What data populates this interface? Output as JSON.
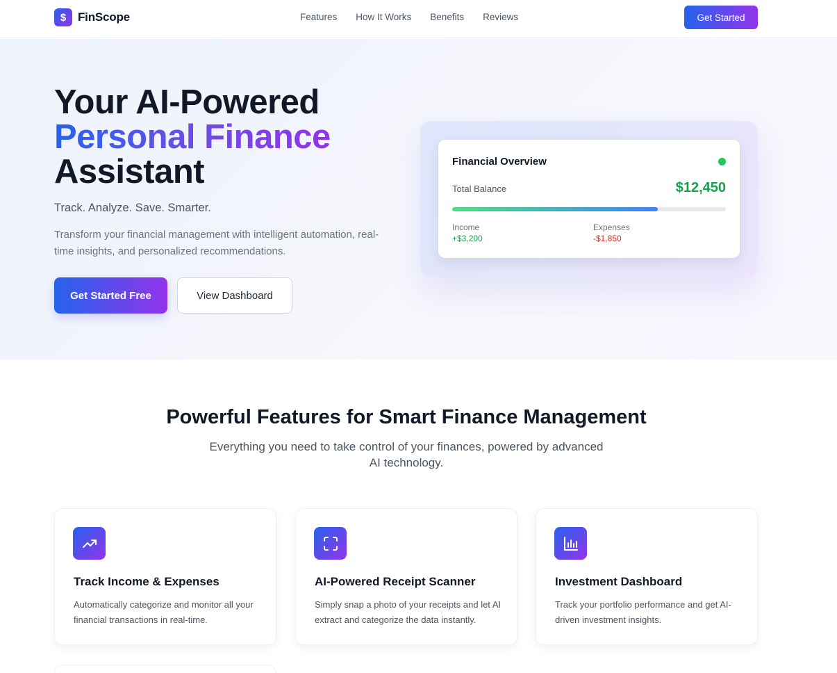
{
  "brand": {
    "logo_glyph": "$",
    "name": "FinScope"
  },
  "nav": {
    "links": [
      "Features",
      "How It Works",
      "Benefits",
      "Reviews"
    ],
    "cta": "Get Started"
  },
  "hero": {
    "title_line1": "Your AI-Powered",
    "title_line2": "Personal Finance",
    "title_line3": "Assistant",
    "tagline": "Track. Analyze. Save. Smarter.",
    "description": "Transform your financial management with intelligent automation, real-time insights, and personalized recommendations.",
    "primary_button": "Get Started Free",
    "secondary_button": "View Dashboard"
  },
  "overview": {
    "title": "Financial Overview",
    "balance_label": "Total Balance",
    "balance": "$12,450",
    "progress_fraction": 0.75,
    "income_label": "Income",
    "income": "+$3,200",
    "expenses_label": "Expenses",
    "expenses": "-$1,850"
  },
  "features": {
    "title": "Powerful Features for Smart Finance Management",
    "subtitle": "Everything you need to take control of your finances, powered by advanced AI technology.",
    "cards": [
      {
        "icon": "trending-up-icon",
        "title": "Track Income & Expenses",
        "description": "Automatically categorize and monitor all your financial transactions in real-time."
      },
      {
        "icon": "scan-icon",
        "title": "AI-Powered Receipt Scanner",
        "description": "Simply snap a photo of your receipts and let AI extract and categorize the data instantly."
      },
      {
        "icon": "bar-chart-icon",
        "title": "Investment Dashboard",
        "description": "Track your portfolio performance and get AI-driven investment insights."
      }
    ]
  },
  "colors": {
    "accent_start": "#2563eb",
    "accent_end": "#9333ea",
    "positive": "#16a34a",
    "negative": "#dc2626"
  }
}
